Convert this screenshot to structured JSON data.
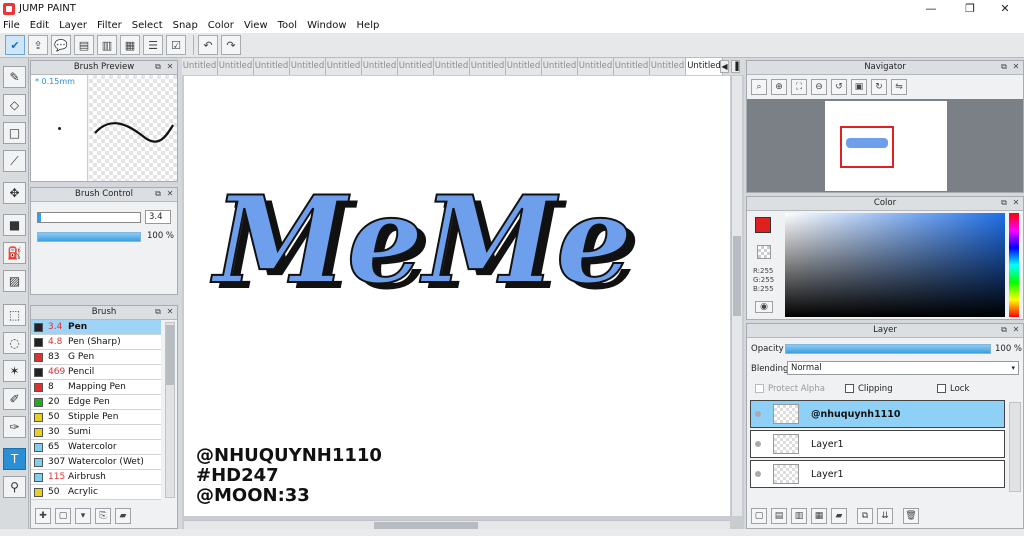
{
  "window": {
    "title": "JUMP PAINT",
    "minimize": "—",
    "maximize": "❐",
    "close": "✕"
  },
  "menu": [
    "File",
    "Edit",
    "Layer",
    "Filter",
    "Select",
    "Snap",
    "Color",
    "View",
    "Tool",
    "Window",
    "Help"
  ],
  "panels": {
    "brush_preview": {
      "title": "Brush Preview",
      "size_label": "* 0.15mm"
    },
    "brush_control": {
      "title": "Brush Control",
      "size_value": "3.4",
      "opacity_value": "100 %"
    },
    "brush": {
      "title": "Brush",
      "items": [
        {
          "size": "3.4",
          "name": "Pen",
          "color": "#222222",
          "size_red": true,
          "selected": true
        },
        {
          "size": "4.8",
          "name": "Pen (Sharp)",
          "color": "#222222",
          "size_red": true
        },
        {
          "size": "83",
          "name": "G Pen",
          "color": "#e03030"
        },
        {
          "size": "469",
          "name": "Pencil",
          "color": "#222222",
          "size_red": true
        },
        {
          "size": "8",
          "name": "Mapping Pen",
          "color": "#e03030"
        },
        {
          "size": "20",
          "name": "Edge Pen",
          "color": "#22aa22"
        },
        {
          "size": "50",
          "name": "Stipple Pen",
          "color": "#e8d020"
        },
        {
          "size": "30",
          "name": "Sumi",
          "color": "#e8d020"
        },
        {
          "size": "65",
          "name": "Watercolor",
          "color": "#7fd0f0"
        },
        {
          "size": "307",
          "name": "Watercolor (Wet)",
          "color": "#7fd0f0"
        },
        {
          "size": "115",
          "name": "Airbrush",
          "color": "#7fd0f0",
          "size_red": true
        },
        {
          "size": "50",
          "name": "Acrylic",
          "color": "#e8d020"
        }
      ]
    },
    "navigator": {
      "title": "Navigator"
    },
    "color": {
      "title": "Color",
      "r": "R:255",
      "g": "G:255",
      "b": "B:255"
    },
    "layer": {
      "title": "Layer",
      "opacity_label": "Opacity",
      "opacity_value": "100 %",
      "blending_label": "Blending",
      "blending_value": "Normal",
      "protect_alpha": "Protect Alpha",
      "clipping": "Clipping",
      "lock": "Lock",
      "layers": [
        {
          "name": "@nhuquynh1110",
          "selected": true
        },
        {
          "name": "Layer1"
        },
        {
          "name": "Layer1"
        }
      ]
    }
  },
  "tabs": [
    "Untitled",
    "Untitled",
    "Untitled",
    "Untitled",
    "Untitled",
    "Untitled",
    "Untitled",
    "Untitled",
    "Untitled",
    "Untitled",
    "Untitled",
    "Untitled",
    "Untitled",
    "Untitled",
    "Untitled"
  ],
  "canvas": {
    "art_text": "MeMe",
    "signature_lines": [
      "@NHUQUYNH1110",
      "#HD247",
      "@MOON:33"
    ]
  },
  "colors": {
    "accent": "#2b8fd6",
    "art_fill": "#6d9fec",
    "primary_color": "#e02020"
  }
}
